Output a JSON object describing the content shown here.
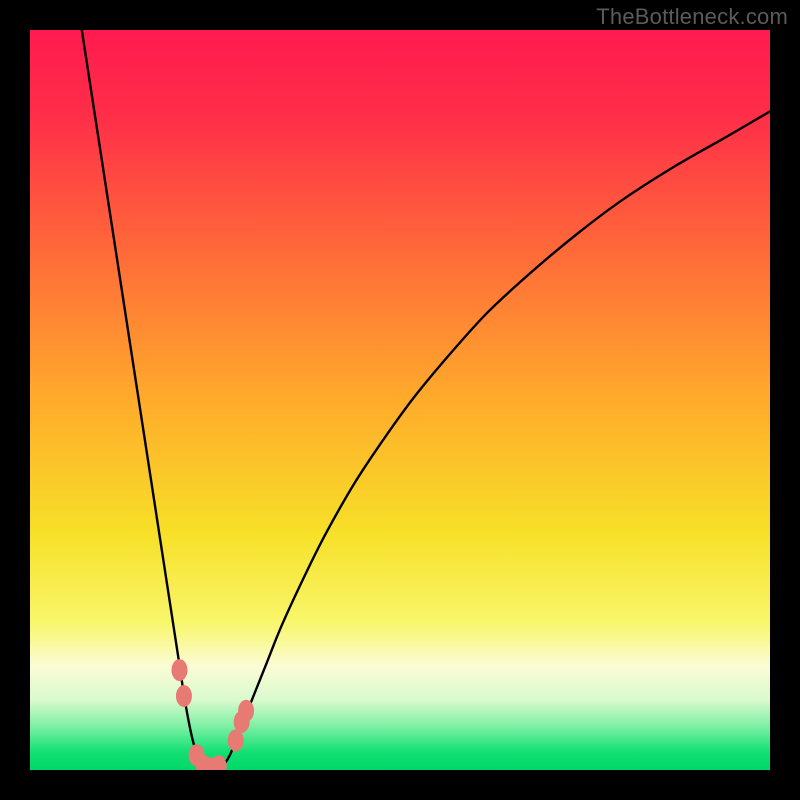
{
  "watermark": "TheBottleneck.com",
  "chart_data": {
    "type": "line",
    "title": "",
    "xlabel": "",
    "ylabel": "",
    "xlim": [
      0,
      100
    ],
    "ylim": [
      0,
      100
    ],
    "grid": false,
    "legend": false,
    "gradient_stops": [
      {
        "offset": 0.0,
        "color": "#ff1a4f"
      },
      {
        "offset": 0.12,
        "color": "#ff2f48"
      },
      {
        "offset": 0.3,
        "color": "#ff6a39"
      },
      {
        "offset": 0.5,
        "color": "#ffab2b"
      },
      {
        "offset": 0.68,
        "color": "#f7e028"
      },
      {
        "offset": 0.8,
        "color": "#f8f66a"
      },
      {
        "offset": 0.86,
        "color": "#fbfcd6"
      },
      {
        "offset": 0.905,
        "color": "#d9facd"
      },
      {
        "offset": 0.94,
        "color": "#80f0a6"
      },
      {
        "offset": 0.975,
        "color": "#14e074"
      },
      {
        "offset": 1.0,
        "color": "#00d868"
      }
    ],
    "series": [
      {
        "name": "bottleneck-curve",
        "x": [
          7,
          8,
          9,
          10,
          11,
          12,
          13,
          14,
          15,
          16,
          17,
          18,
          19,
          20,
          21,
          22,
          23,
          24,
          25,
          26,
          27,
          28,
          30,
          32,
          34,
          37,
          40,
          44,
          48,
          52,
          57,
          62,
          68,
          74,
          80,
          87,
          94,
          100
        ],
        "y": [
          100,
          93.5,
          87,
          80.5,
          74,
          67.5,
          61,
          54.5,
          48,
          41.5,
          35,
          28.5,
          22,
          15.5,
          9,
          4,
          1,
          0,
          0,
          0.5,
          2,
          4.5,
          9.5,
          14.5,
          19.5,
          26,
          32,
          39,
          45,
          50.5,
          56.5,
          62,
          67.5,
          72.5,
          77,
          81.5,
          85.5,
          89
        ]
      }
    ],
    "markers": [
      {
        "x": 20.2,
        "y": 13.5
      },
      {
        "x": 20.8,
        "y": 10.0
      },
      {
        "x": 22.5,
        "y": 2.0
      },
      {
        "x": 23.5,
        "y": 0.5
      },
      {
        "x": 24.5,
        "y": 0.2
      },
      {
        "x": 25.5,
        "y": 0.5
      },
      {
        "x": 27.8,
        "y": 4.0
      },
      {
        "x": 28.6,
        "y": 6.5
      },
      {
        "x": 29.2,
        "y": 8.0
      }
    ]
  }
}
